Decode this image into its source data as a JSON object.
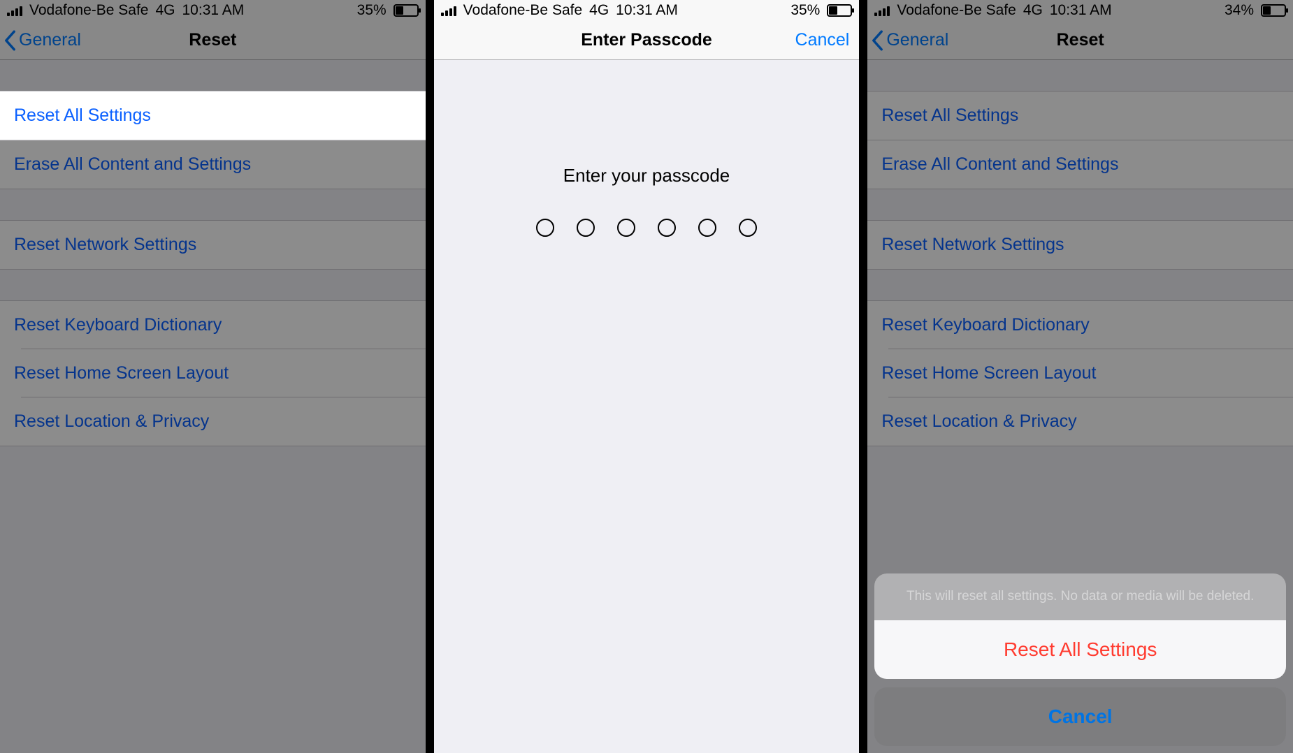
{
  "status": {
    "carrier": "Vodafone-Be Safe",
    "network": "4G",
    "time": "10:31 AM",
    "battery1": "35%",
    "battery2": "35%",
    "battery3": "34%"
  },
  "nav": {
    "back": "General",
    "title": "Reset"
  },
  "reset_rows": {
    "reset_all": "Reset All Settings",
    "erase_all": "Erase All Content and Settings",
    "reset_network": "Reset Network Settings",
    "reset_keyboard": "Reset Keyboard Dictionary",
    "reset_home": "Reset Home Screen Layout",
    "reset_location": "Reset Location & Privacy"
  },
  "passcode": {
    "title": "Enter Passcode",
    "cancel": "Cancel",
    "prompt": "Enter your passcode"
  },
  "sheet": {
    "message": "This will reset all settings. No data or media will be deleted.",
    "confirm": "Reset All Settings",
    "cancel": "Cancel"
  }
}
